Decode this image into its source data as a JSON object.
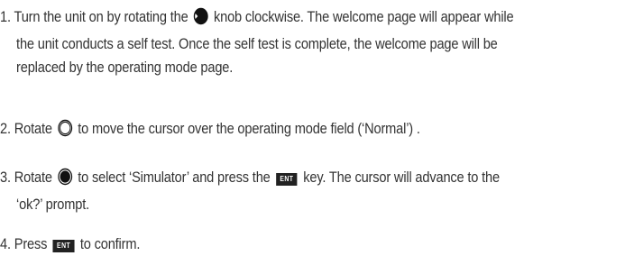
{
  "steps": [
    {
      "number": "1.",
      "line1_a": "Turn the unit on by rotating the",
      "line1_icon": "half-filled-knob-icon",
      "line1_b": "knob clockwise. The welcome page will appear while",
      "line2": "the unit conducts a self test. Once the self test is complete, the welcome page will be",
      "line3": "replaced by the operating mode page."
    },
    {
      "number": "2.",
      "line1_a": "Rotate",
      "line1_icon": "outline-knob-icon",
      "line1_b": "to move the cursor over the operating mode field (‘Normal’) ."
    },
    {
      "number": "3.",
      "line1_a": "Rotate",
      "line1_icon": "filled-knob-icon",
      "line1_b": "to select ‘Simulator’ and press the",
      "key_label": "ENT",
      "line1_c": "key. The cursor will advance to the",
      "line2": "‘ok?’ prompt."
    },
    {
      "number": "4.",
      "line1_a": "Press",
      "key_label": "ENT",
      "line1_b": "to confirm."
    }
  ]
}
